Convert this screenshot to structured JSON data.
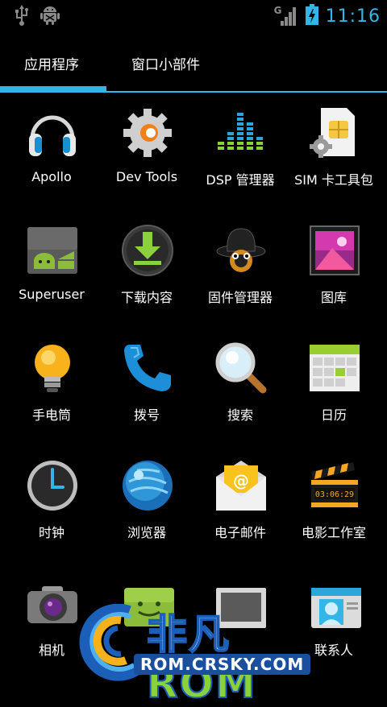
{
  "status_bar": {
    "time": "11:16",
    "network_label": "G",
    "icons": [
      "usb-icon",
      "android-debug-icon",
      "signal-icon",
      "battery-charging-icon"
    ]
  },
  "tabs": [
    {
      "label": "应用程序",
      "selected": true
    },
    {
      "label": "窗口小部件",
      "selected": false
    }
  ],
  "apps": [
    {
      "label": "Apollo",
      "icon": "headphones-icon"
    },
    {
      "label": "Dev Tools",
      "icon": "gear-icon"
    },
    {
      "label": "DSP 管理器",
      "icon": "equalizer-icon"
    },
    {
      "label": "SIM 卡工具包",
      "icon": "sim-card-icon"
    },
    {
      "label": "Superuser",
      "icon": "android-icon"
    },
    {
      "label": "下载内容",
      "icon": "download-icon"
    },
    {
      "label": "固件管理器",
      "icon": "clockwork-hat-icon"
    },
    {
      "label": "图库",
      "icon": "gallery-icon"
    },
    {
      "label": "手电筒",
      "icon": "lightbulb-icon"
    },
    {
      "label": "拨号",
      "icon": "phone-icon"
    },
    {
      "label": "搜索",
      "icon": "magnifier-icon"
    },
    {
      "label": "日历",
      "icon": "calendar-icon"
    },
    {
      "label": "时钟",
      "icon": "clock-icon"
    },
    {
      "label": "浏览器",
      "icon": "globe-icon"
    },
    {
      "label": "电子邮件",
      "icon": "email-icon"
    },
    {
      "label": "电影工作室",
      "icon": "clapperboard-icon"
    },
    {
      "label": "相机",
      "icon": "camera-icon"
    },
    {
      "label": "",
      "icon": "messaging-icon"
    },
    {
      "label": "",
      "icon": "music-icon"
    },
    {
      "label": "联系人",
      "icon": "contacts-icon"
    }
  ],
  "clapperboard_text": "03:06:29",
  "email_symbol": "@",
  "watermark": {
    "text_a": "非凡",
    "text_b": "ROM",
    "url": "ROM.CRSKY.COM"
  },
  "colors": {
    "accent": "#33b5e5",
    "background": "#000000"
  }
}
